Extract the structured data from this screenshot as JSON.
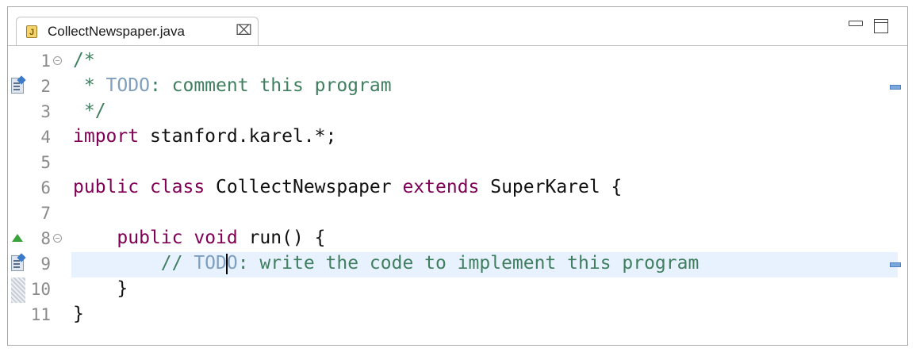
{
  "tab": {
    "file_icon_letter": "J",
    "label": "CollectNewspaper.java",
    "close_glyph": "⌧"
  },
  "window_buttons": {
    "minimize": "minimize-icon",
    "maximize": "maximize-icon"
  },
  "lines": [
    {
      "num": "1",
      "fold": true
    },
    {
      "num": "2",
      "marker": "task-icon",
      "overview": true
    },
    {
      "num": "3"
    },
    {
      "num": "4"
    },
    {
      "num": "5"
    },
    {
      "num": "6"
    },
    {
      "num": "7"
    },
    {
      "num": "8",
      "fold": true,
      "marker": "override-icon"
    },
    {
      "num": "9",
      "marker": "task-icon",
      "highlight": true,
      "overview": true
    },
    {
      "num": "10",
      "marker": "dots"
    },
    {
      "num": "11"
    }
  ],
  "code": {
    "l1": "/*",
    "l2_star": " * ",
    "l2_todo": "TODO",
    "l2_rest": ": comment this program",
    "l3": " */",
    "l4_kw": "import",
    "l4_rest": " stanford.karel.*;",
    "l6_kw1": "public",
    "l6_kw2": "class",
    "l6_name": " CollectNewspaper ",
    "l6_kw3": "extends",
    "l6_rest": " SuperKarel {",
    "l8_indent": "    ",
    "l8_kw1": "public",
    "l8_kw2": "void",
    "l8_rest": " run() {",
    "l9_prefix": "        // ",
    "l9_todo_a": "TOD",
    "l9_todo_b": "O",
    "l9_rest": ": write the code to implement this program",
    "l10": "    }",
    "l11": "}"
  },
  "colors": {
    "keyword": "#7f0055",
    "comment": "#3f7f5f",
    "todo": "#7f9fbf",
    "current_line": "#e8f2fe"
  }
}
